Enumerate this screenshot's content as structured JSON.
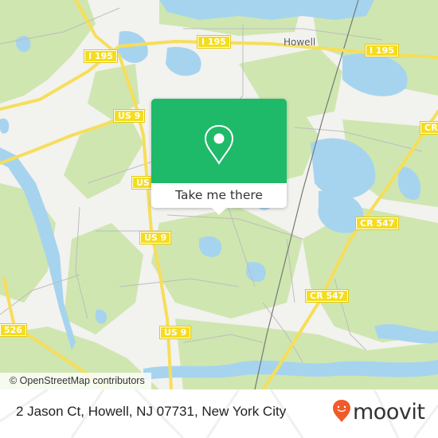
{
  "map": {
    "place_labels": [
      {
        "name": "town-howell",
        "text": "Howell"
      }
    ],
    "road_shields": [
      {
        "id": "i195-west",
        "text": "I 195"
      },
      {
        "id": "i195-center",
        "text": "I 195"
      },
      {
        "id": "i195-east",
        "text": "I 195"
      },
      {
        "id": "us9-upper",
        "text": "US 9"
      },
      {
        "id": "us9-mid",
        "text": "US"
      },
      {
        "id": "us9-lower",
        "text": "US 9"
      },
      {
        "id": "us9-bottom",
        "text": "US 9"
      },
      {
        "id": "cr547-upper",
        "text": "CR 547"
      },
      {
        "id": "cr547-lower",
        "text": "CR 547"
      },
      {
        "id": "cr-edge",
        "text": "CR"
      },
      {
        "id": "cr526",
        "text": "526"
      }
    ],
    "attribution": "© OpenStreetMap contributors",
    "colors": {
      "land": "#f2f2ef",
      "wood": "#cfe6b0",
      "water": "#a6d4ef",
      "highway": "#f6de5a",
      "minor_road": "#bdbdbd",
      "rail": "#777777"
    }
  },
  "popup": {
    "icon": "location-pin-icon",
    "action_label": "Take me there",
    "color": "#1fb96a"
  },
  "footer": {
    "address": "2 Jason Ct, Howell, NJ 07731, New York City",
    "brand": "moovit",
    "brand_icon": "moovit-pin-smile-icon",
    "brand_color": "#f15a2b"
  }
}
